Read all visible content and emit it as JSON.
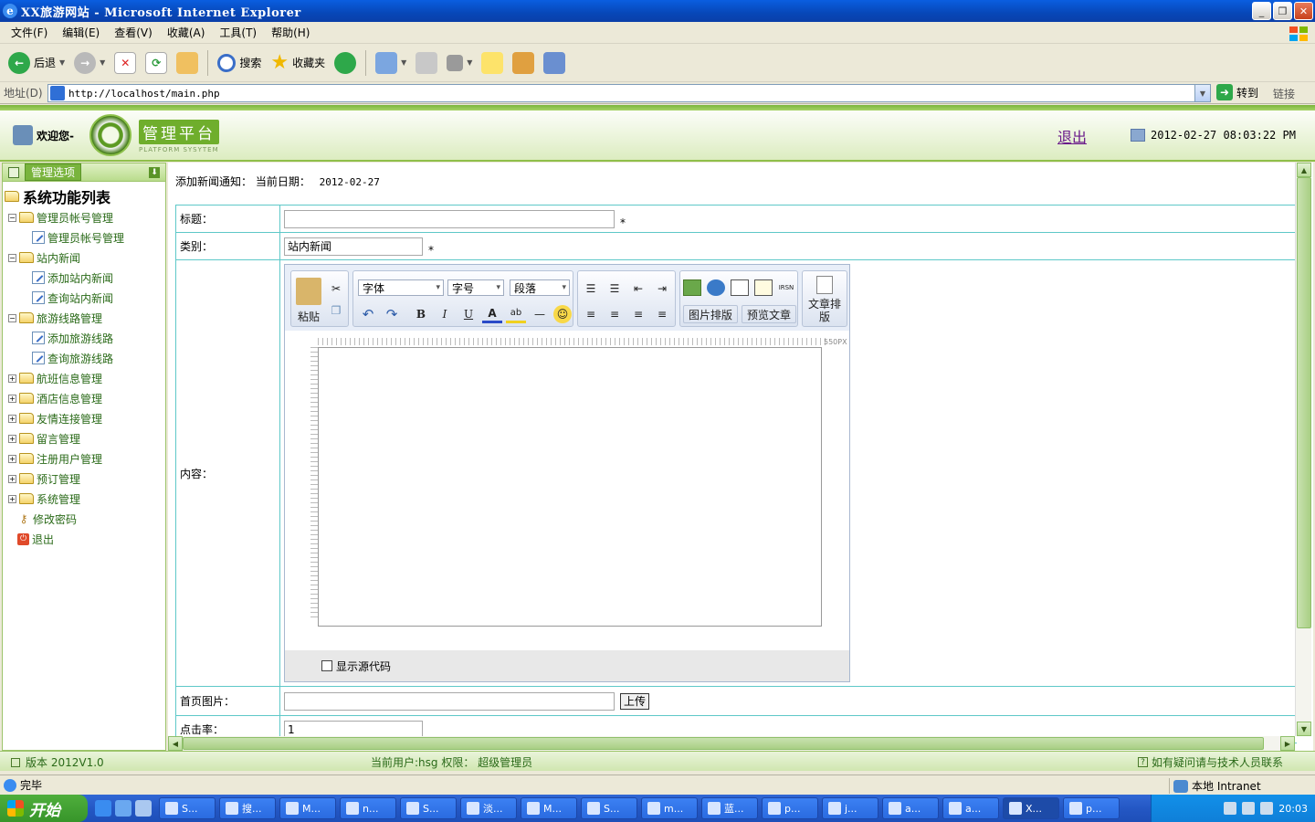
{
  "window": {
    "title": "XX旅游网站 - Microsoft Internet Explorer"
  },
  "menubar": [
    "文件(F)",
    "编辑(E)",
    "查看(V)",
    "收藏(A)",
    "工具(T)",
    "帮助(H)"
  ],
  "toolbar": {
    "back_label": "后退",
    "search_label": "搜索",
    "favorites_label": "收藏夹"
  },
  "address": {
    "label": "地址(D)",
    "url": "http://localhost/main.php",
    "go_label": "转到",
    "links_label": "链接"
  },
  "header": {
    "welcome": "欢迎您-",
    "logo_cn": "管理平台",
    "logo_en": "PLATFORM SYSYTEM",
    "logout": "退出",
    "datetime": "2012-02-27 08:03:22 PM"
  },
  "sidebar": {
    "header_label": "管理选项",
    "root_label": "系统功能列表",
    "items": [
      {
        "label": "管理员帐号管理",
        "level": 1,
        "expanded": true
      },
      {
        "label": "管理员帐号管理",
        "level": 2
      },
      {
        "label": "站内新闻",
        "level": 1,
        "expanded": true
      },
      {
        "label": "添加站内新闻",
        "level": 2
      },
      {
        "label": "查询站内新闻",
        "level": 2
      },
      {
        "label": "旅游线路管理",
        "level": 1,
        "expanded": true
      },
      {
        "label": "添加旅游线路",
        "level": 2
      },
      {
        "label": "查询旅游线路",
        "level": 2
      },
      {
        "label": "航班信息管理",
        "level": 1,
        "expanded": false
      },
      {
        "label": "酒店信息管理",
        "level": 1,
        "expanded": false
      },
      {
        "label": "友情连接管理",
        "level": 1,
        "expanded": false
      },
      {
        "label": "留言管理",
        "level": 1,
        "expanded": false
      },
      {
        "label": "注册用户管理",
        "level": 1,
        "expanded": false
      },
      {
        "label": "预订管理",
        "level": 1,
        "expanded": false
      },
      {
        "label": "系统管理",
        "level": 1,
        "expanded": false
      },
      {
        "label": "修改密码",
        "level": 1,
        "kind": "key"
      },
      {
        "label": "退出",
        "level": 1,
        "kind": "exit"
      }
    ]
  },
  "main": {
    "notice_label": "添加新闻通知：  当前日期：",
    "notice_date": "2012-02-27",
    "form": {
      "title_label": "标题：",
      "title_value": "",
      "category_label": "类别：",
      "category_value": "站内新闻",
      "required_mark": "*",
      "content_label": "内容：",
      "image_label": "首页图片：",
      "image_value": "",
      "upload_label": "上传",
      "clicks_label": "点击率：",
      "clicks_value": "1"
    },
    "editor": {
      "paste_label": "粘贴",
      "font_select": "字体",
      "size_select": "字号",
      "para_select": "段落",
      "image_layout_label": "图片排版",
      "preview_label": "预览文章",
      "article_layout_label": "文章排版",
      "ruler_label": "550PX",
      "show_source_label": "显示源代码"
    }
  },
  "footer": {
    "version": "版本 2012V1.0",
    "current_user": "当前用户:hsg 权限： 超级管理员",
    "contact": "如有疑问请与技术人员联系"
  },
  "statusbar": {
    "status": "完毕",
    "zone": "本地 Intranet"
  },
  "taskbar": {
    "start_label": "开始",
    "tasks": [
      "S...",
      "搜...",
      "M...",
      "n...",
      "S...",
      "淡...",
      "M...",
      "S...",
      "m...",
      "蓝...",
      "p...",
      "j...",
      "a...",
      "a...",
      "X...",
      "p..."
    ],
    "clock": "20:03"
  }
}
